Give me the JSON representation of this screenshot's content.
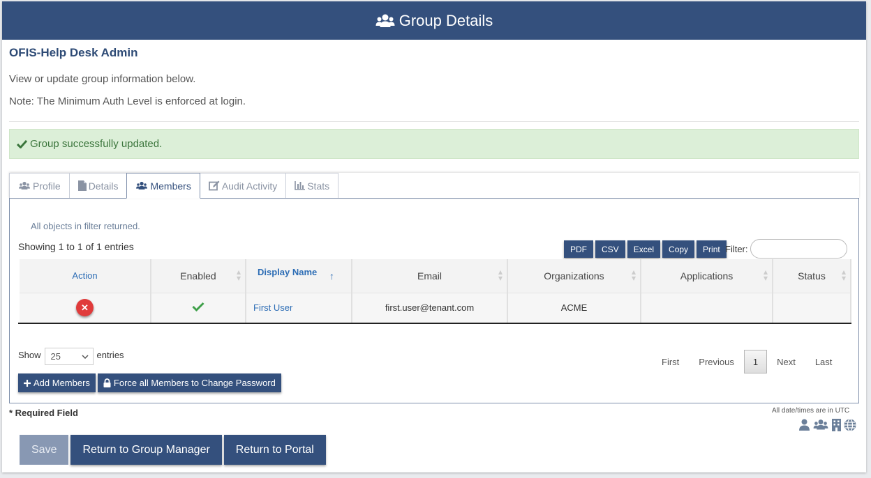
{
  "header": {
    "title": "Group Details"
  },
  "group": {
    "name": "OFIS-Help Desk Admin",
    "description": "View or update group information below.",
    "note": "Note: The Minimum Auth Level is enforced at login."
  },
  "alert": {
    "message": "Group successfully updated."
  },
  "tabs": [
    {
      "label": "Profile",
      "icon": "users-icon"
    },
    {
      "label": "Details",
      "icon": "document-icon"
    },
    {
      "label": "Members",
      "icon": "users-icon",
      "active": true
    },
    {
      "label": "Audit Activity",
      "icon": "edit-icon"
    },
    {
      "label": "Stats",
      "icon": "bar-chart-icon"
    }
  ],
  "members": {
    "filter_note": "All objects in filter returned.",
    "showing": "Showing 1 to 1 of 1 entries",
    "export_buttons": [
      "PDF",
      "CSV",
      "Excel",
      "Copy",
      "Print"
    ],
    "filter_label": "Filter:",
    "filter_value": "",
    "columns": [
      "Action",
      "Enabled",
      "Display Name",
      "Email",
      "Organizations",
      "Applications",
      "Status"
    ],
    "rows": [
      {
        "action": "remove",
        "enabled": true,
        "display_name": "First User",
        "email": "first.user@tenant.com",
        "organizations": "ACME",
        "applications": "",
        "status": ""
      }
    ],
    "show_label": "Show",
    "page_length": "25",
    "entries_label": "entries",
    "pagination": {
      "first": "First",
      "previous": "Previous",
      "current": "1",
      "next": "Next",
      "last": "Last"
    },
    "add_members_label": "Add Members",
    "force_password_label": "Force all Members to Change Password"
  },
  "footer": {
    "required_note": "* Required Field",
    "utc_note": "All date/times are in UTC",
    "save_label": "Save",
    "return_group_manager_label": "Return to Group Manager",
    "return_portal_label": "Return to Portal"
  },
  "colors": {
    "primary": "#34507d",
    "success_bg": "#dcefd8",
    "success_text": "#3c763d",
    "link": "#2d6db5",
    "danger": "#e03b3b"
  }
}
